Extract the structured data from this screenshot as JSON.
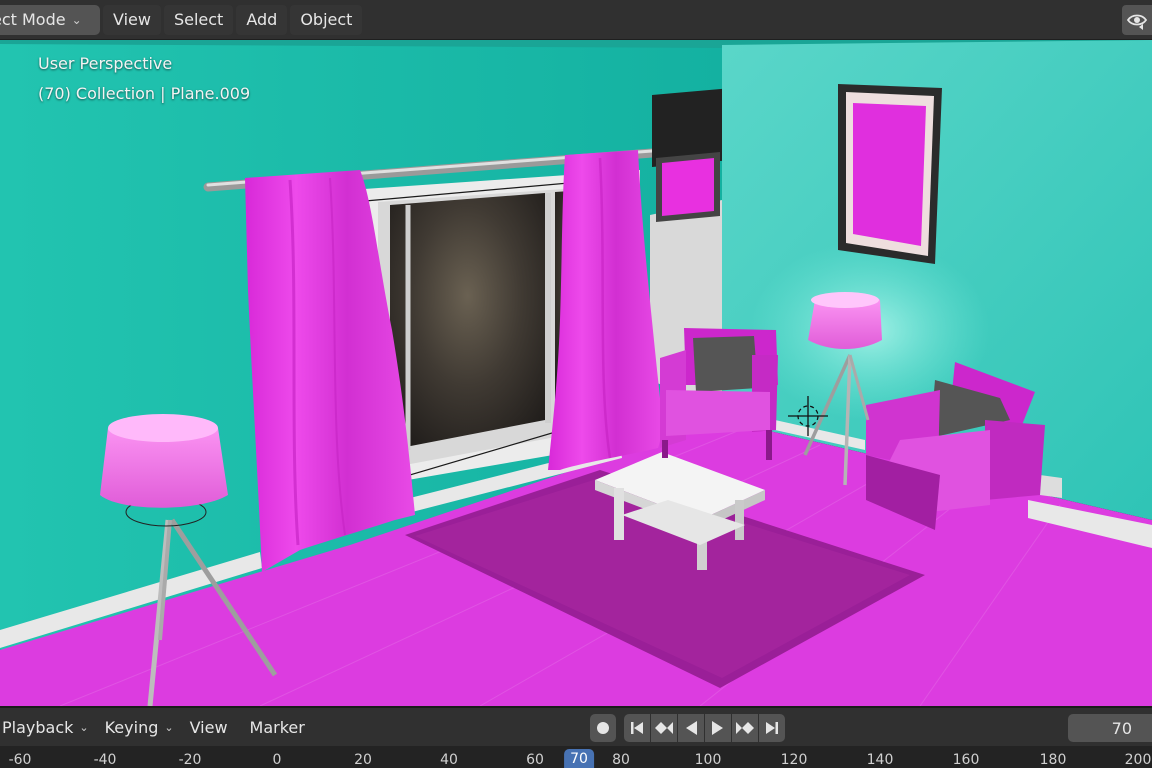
{
  "header": {
    "mode_label": "ect Mode",
    "menu": [
      "View",
      "Select",
      "Add",
      "Object"
    ]
  },
  "viewport": {
    "perspective_label": "User Perspective",
    "collection_label": "(70) Collection | Plane.009"
  },
  "timeline": {
    "menus": {
      "playback": "Playback",
      "keying": "Keying",
      "view": "View",
      "marker": "Marker"
    },
    "current_frame": "70",
    "ruler_ticks": [
      "-60",
      "-40",
      "-20",
      "0",
      "20",
      "40",
      "60",
      "80",
      "100",
      "120",
      "140",
      "160",
      "180",
      "200"
    ],
    "ruler_current": "70"
  },
  "icons": {
    "viewport_visibility": "eye-icon",
    "record": "record-icon",
    "jump_start": "jump-to-start-icon",
    "prev_key": "previous-keyframe-icon",
    "play_reverse": "play-reverse-icon",
    "play": "play-icon",
    "next_key": "next-keyframe-icon",
    "jump_end": "jump-to-end-icon"
  },
  "colors": {
    "wall": "#1fc0ad",
    "floor": "#dc3ce0",
    "rug": "#9a1e98",
    "curtain": "#e233e0",
    "ui_panel": "#303030",
    "accent_blue": "#4772b3"
  }
}
